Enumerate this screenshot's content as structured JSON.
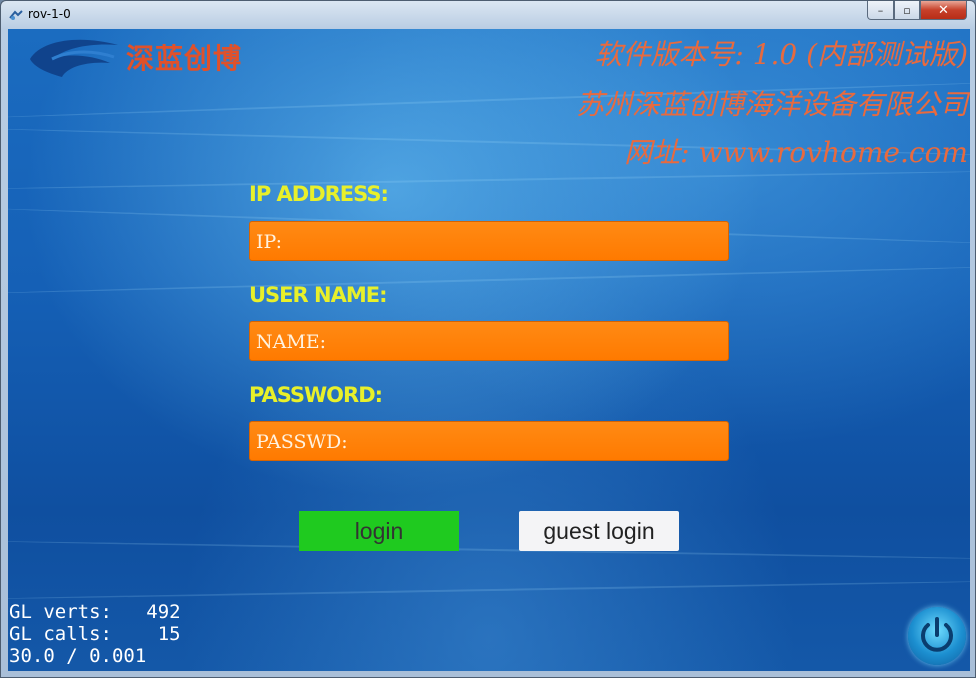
{
  "window": {
    "title": "rov-1-0",
    "controls": {
      "minimize": "–",
      "maximize": "▫",
      "close": "✕"
    }
  },
  "header": {
    "brand": "深蓝创博",
    "version_line": "软件版本号: 1.0 (内部测试版)",
    "company_line": "苏州深蓝创博海洋设备有限公司",
    "website_line": "网址: www.rovhome.com"
  },
  "form": {
    "ip_label": "IP ADDRESS:",
    "ip_placeholder": "IP:",
    "user_label": "USER NAME:",
    "user_placeholder": "NAME:",
    "password_label": "PASSWORD:",
    "password_placeholder": "PASSWD:"
  },
  "buttons": {
    "login": "login",
    "guest_login": "guest login"
  },
  "stats": {
    "verts_line": "GL verts:   492",
    "calls_line": "GL calls:    15",
    "fps_line": "30.0 / 0.001"
  },
  "icons": {
    "app_icon": "app-icon",
    "logo": "wave-logo-icon",
    "power": "power-icon"
  },
  "colors": {
    "brand_text": "#e0512a",
    "info_text": "#e86a3e",
    "field_label": "#e8f02a",
    "field_bg": "#ff7a00",
    "login_button": "#1fca1f",
    "guest_button": "#f4f4f6"
  }
}
